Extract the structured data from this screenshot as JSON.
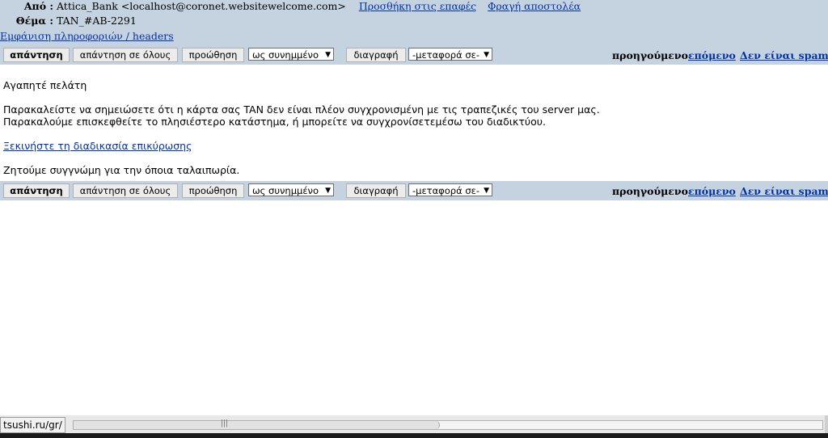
{
  "header": {
    "from_label": "Από :",
    "from_value": "Attica_Bank <localhost@coronet.websitewelcome.com>",
    "add_contact": "Προσθήκη στις επαφές",
    "block_sender": "Φραγή αποστολέα",
    "subject_label": "Θέμα :",
    "subject_value": "TAN_#AB-2291",
    "show_headers": "Εμφάνιση πληροφοριών / headers"
  },
  "toolbar": {
    "reply": "απάντηση",
    "reply_all": "απάντηση σε όλους",
    "forward": "προώθηση",
    "forward_mode": "ως συνημμένο",
    "delete": "διαγραφή",
    "move_to": "-μεταφορά σε-",
    "previous": "προηγούμενο",
    "next": "επόμενο",
    "not_spam": "Δεν είναι spam"
  },
  "message": {
    "greeting": "Αγαπητέ πελάτη",
    "line1": "Παρακαλείστε να σημειώσετε ότι η κάρτα σας TAN δεν είναι πλέον συγχρονισμένη με τις τραπεζικές του server μας.",
    "line2": "Παρακαλούμε επισκεφθείτε το πλησιέστερο κατάστημα, ή μπορείτε να συγχρονίσετεμέσω του διαδικτύου.",
    "link": "Ξεκινήστε τη διαδικασία επικύρωσης",
    "closing": "Ζητούμε συγγνώμη για την όποια ταλαιπωρία."
  },
  "status": {
    "url": "tsushi.ru/gr/"
  }
}
